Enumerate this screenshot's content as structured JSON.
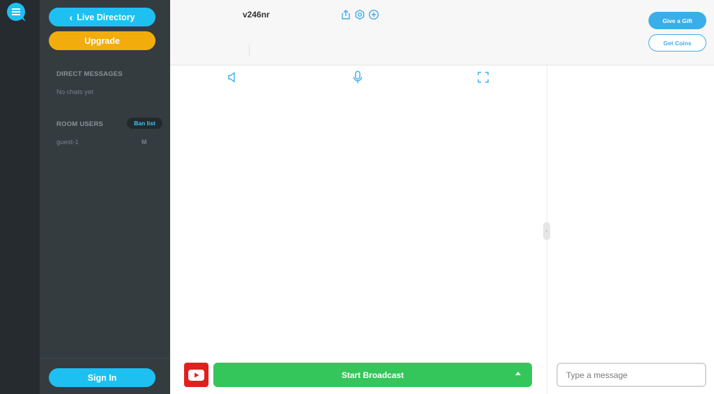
{
  "sidebar": {
    "live_directory": "Live Directory",
    "upgrade": "Upgrade",
    "direct_messages_title": "DIRECT MESSAGES",
    "no_chats": "No chats yet",
    "room_users_title": "ROOM USERS",
    "ban_list": "Ban list",
    "users": [
      {
        "name": "guest-1",
        "badge": "M"
      }
    ],
    "sign_in": "Sign In"
  },
  "header": {
    "room_name": "v246nr",
    "icons": [
      "share-icon",
      "settings-icon",
      "add-icon"
    ],
    "give_gift": "Give a Gift",
    "get_coins": "Get Coins"
  },
  "media_controls": [
    "speaker-icon",
    "microphone-icon",
    "fullscreen-icon"
  ],
  "broadcast": {
    "start_label": "Start Broadcast",
    "youtube_icon": "youtube-icon"
  },
  "chat": {
    "input_placeholder": "Type a message"
  },
  "colors": {
    "accent_blue": "#1ec0f2",
    "upgrade_orange": "#f2ad0c",
    "broadcast_green": "#34c65a",
    "youtube_red": "#e51d1d",
    "sidebar_bg": "#343c40",
    "rail_bg": "#252b2e"
  }
}
